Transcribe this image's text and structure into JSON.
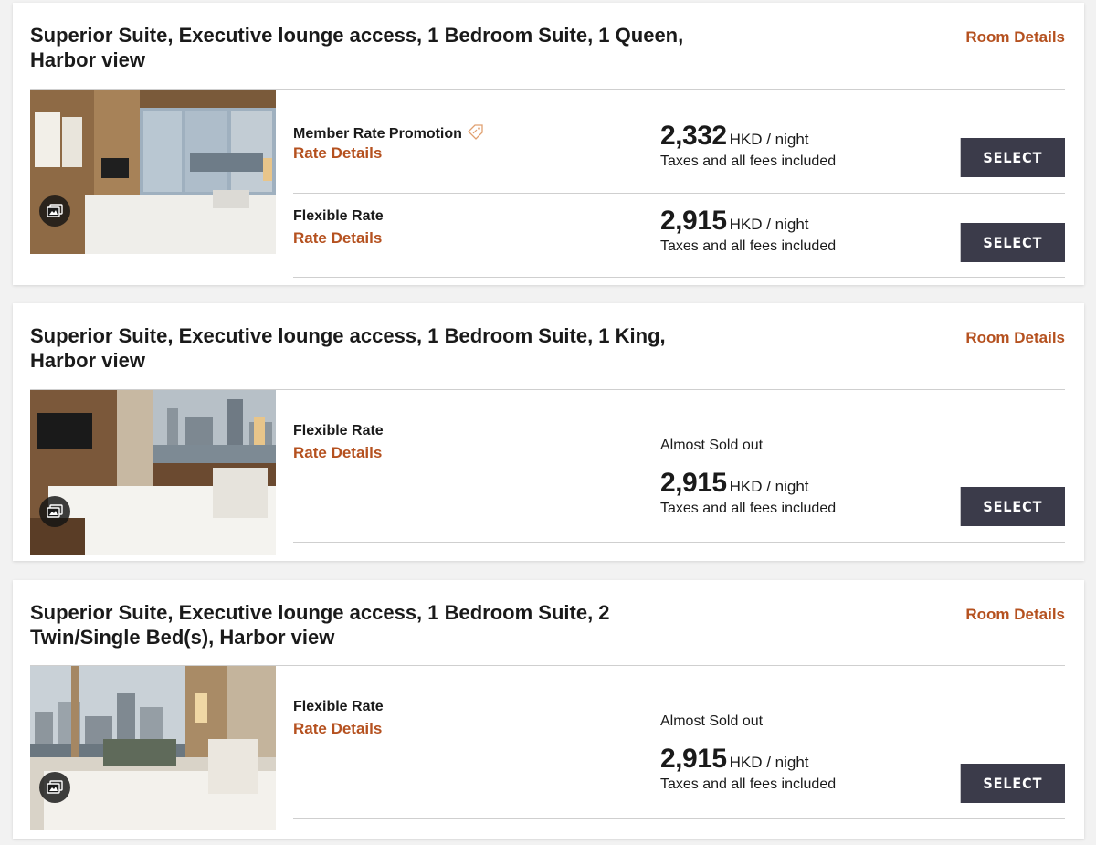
{
  "rooms": [
    {
      "title": "Superior Suite, Executive lounge access, 1 Bedroom Suite, 1 Queen, Harbor view",
      "room_details_label": "Room Details",
      "photo_icon": "gallery-icon",
      "rates": [
        {
          "name": "Member Rate Promotion",
          "has_tag_icon": true,
          "details_label": "Rate Details",
          "availability": "",
          "price": "2,332",
          "unit": "HKD / night",
          "taxes": "Taxes and all fees included",
          "select_label": "SELECT"
        },
        {
          "name": "Flexible Rate",
          "details_label": "Rate Details",
          "availability": "",
          "price": "2,915",
          "unit": "HKD / night",
          "taxes": "Taxes and all fees included",
          "select_label": "SELECT"
        }
      ]
    },
    {
      "title": "Superior Suite, Executive lounge access, 1 Bedroom Suite, 1 King, Harbor view",
      "room_details_label": "Room Details",
      "photo_icon": "gallery-icon",
      "rates": [
        {
          "name": "Flexible Rate",
          "details_label": "Rate Details",
          "availability": "Almost Sold out",
          "price": "2,915",
          "unit": "HKD / night",
          "taxes": "Taxes and all fees included",
          "select_label": "SELECT"
        }
      ]
    },
    {
      "title": "Superior Suite, Executive lounge access, 1 Bedroom Suite, 2 Twin/Single Bed(s), Harbor view",
      "room_details_label": "Room Details",
      "photo_icon": "gallery-icon",
      "rates": [
        {
          "name": "Flexible Rate",
          "details_label": "Rate Details",
          "availability": "Almost Sold out",
          "price": "2,915",
          "unit": "HKD / night",
          "taxes": "Taxes and all fees included",
          "select_label": "SELECT"
        }
      ]
    }
  ],
  "colors": {
    "accent": "#b5511f",
    "button": "#3b3b4a",
    "background": "#f2f2f2"
  }
}
